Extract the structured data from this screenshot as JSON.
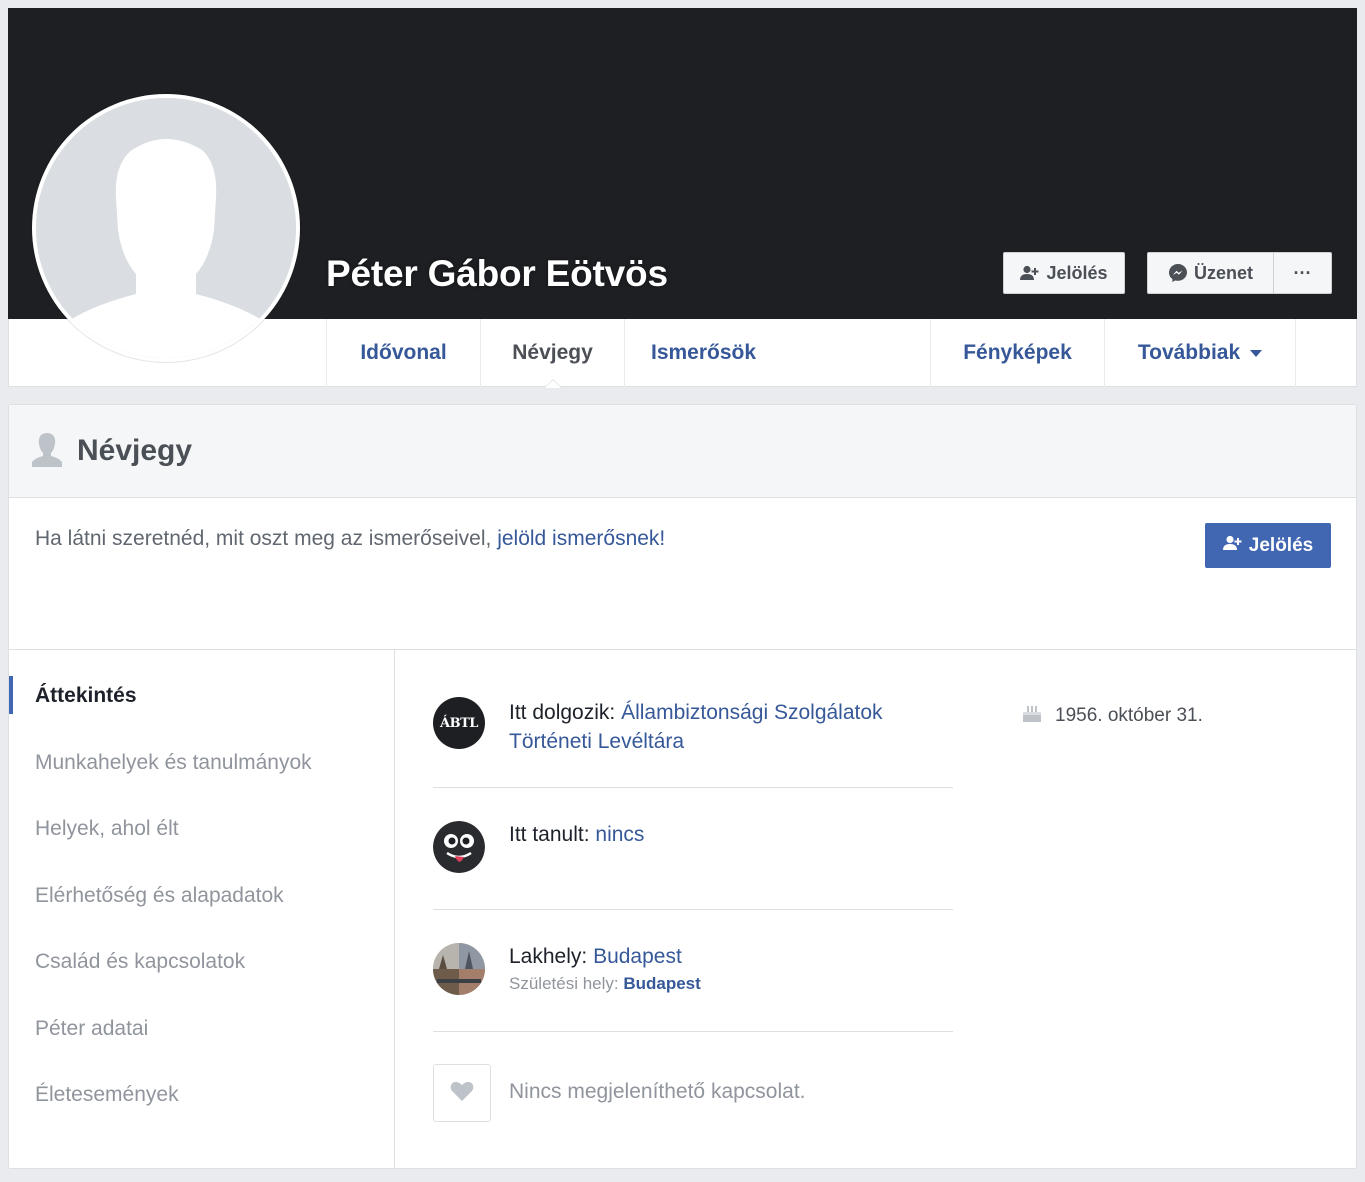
{
  "profile": {
    "name": "Péter Gábor Eötvös"
  },
  "actions": {
    "add_friend_label": "Jelölés",
    "message_label": "Üzenet",
    "more_label": "···"
  },
  "tabs": [
    {
      "label": "Idővonal"
    },
    {
      "label": "Névjegy"
    },
    {
      "label": "Ismerősök"
    },
    {
      "label": "Fényképek"
    },
    {
      "label": "Továbbiak"
    }
  ],
  "about": {
    "title": "Névjegy",
    "notice_text": "Ha látni szeretnéd, mit oszt meg az ismerőseivel, ",
    "notice_link": "jelöld ismerősnek!",
    "add_button_label": "Jelölés"
  },
  "sidebar": {
    "items": [
      {
        "label": "Áttekintés"
      },
      {
        "label": "Munkahelyek és tanulmányok"
      },
      {
        "label": "Helyek, ahol élt"
      },
      {
        "label": "Elérhetőség és alapadatok"
      },
      {
        "label": "Család és kapcsolatok"
      },
      {
        "label": "Péter adatai"
      },
      {
        "label": "Életesemények"
      }
    ]
  },
  "overview": {
    "work_prefix": "Itt dolgozik: ",
    "work_line1": "Állambiztonsági Szolgálatok",
    "work_line2": "Történeti Levéltára",
    "work_logo_text": "ÁBTL",
    "study_prefix": "Itt tanult: ",
    "study_value": "nincs",
    "home_prefix": "Lakhely: ",
    "home_value": "Budapest",
    "birthplace_prefix": "Születési hely: ",
    "birthplace_value": "Budapest",
    "relationship_text": "Nincs megjeleníthető kapcsolat.",
    "birthday": "1956. október 31."
  },
  "colors": {
    "cover": "#1d1f23",
    "link": "#365899",
    "primary_button": "#4267b2"
  }
}
